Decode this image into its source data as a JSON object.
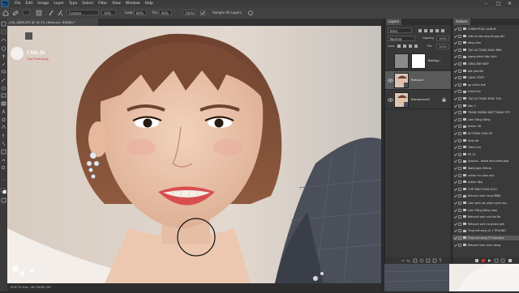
{
  "menubar": {
    "items": [
      "File",
      "Edit",
      "Image",
      "Layer",
      "Type",
      "Select",
      "Filter",
      "View",
      "Window",
      "Help"
    ]
  },
  "options": {
    "mode_value": "Custom",
    "flow_label": "Flow:",
    "flow_value": "10%",
    "smoothing_label": "Look:",
    "smoothing_value": "80%",
    "flow2_label": "Flo:",
    "flow2_value": "90%",
    "zoom_value": "100%",
    "sample_all_label": "Sample All Layers"
  },
  "document": {
    "tab_title": "LOA_0665.JPG @ 16.7% (Retouch, RGB/8) *",
    "watermark_line1": "Chia Sẻ",
    "watermark_line2": "Tạo Photoshop",
    "status_text": "16.67%   Doc: 46.1M/89.2M"
  },
  "layers_panel": {
    "tab_label": "Layers",
    "kind_label": "Kind",
    "blend_mode": "Normal",
    "opacity_label": "Opacity:",
    "opacity_value": "100%",
    "lock_label": "Lock:",
    "fill_label": "Fill:",
    "fill_value": "100%",
    "layers": [
      {
        "name": "Backgr...",
        "type": "mask"
      },
      {
        "name": "Retouch",
        "type": "photo"
      },
      {
        "name": "Background",
        "type": "photo"
      }
    ]
  },
  "actions_panel": {
    "tab_label": "Actions",
    "items": [
      {
        "label": "CHINH PHỤC ALBUM",
        "check": true
      },
      {
        "label": "viết và hòa ứng khung hắn",
        "check": true
      },
      {
        "label": "tăng cảm",
        "check": true
      },
      {
        "label": "TẠO ACTIONS XOAY ẢNH",
        "check": true
      },
      {
        "label": "mạng tránh đàu lành",
        "check": true
      },
      {
        "label": "LÊNG ẢNH ĐẸP",
        "check": true
      },
      {
        "label": "bật phá tắc",
        "check": true
      },
      {
        "label": "LÀNH TỐMT",
        "check": true
      },
      {
        "label": "ụp chính ảnh",
        "check": true
      },
      {
        "label": "tránh thu",
        "check": true
      },
      {
        "label": "TẠO ACTIONS XOAY THA",
        "check": true
      },
      {
        "label": "Ván 1",
        "check": true
      },
      {
        "label": "TRANG ĐIÊNG ĐẸP TRANG PTS",
        "check": true
      },
      {
        "label": "Làm Trắng Răng",
        "check": true
      },
      {
        "label": "Action 28",
        "check": true
      },
      {
        "label": "ACTIONS CHIA SẺ",
        "check": true
      },
      {
        "label": "khác đa",
        "check": true
      },
      {
        "label": "Tránh thu",
        "check": true
      },
      {
        "label": "PS 11",
        "check": true
      },
      {
        "label": "Actions - blend and clean.psq",
        "check": true
      },
      {
        "label": "Wall/Light Effects",
        "check": true
      },
      {
        "label": "action hu chan anh",
        "check": true
      },
      {
        "label": "action đẹp",
        "check": true
      },
      {
        "label": "THÊ MAN TUAN 2022",
        "check": true
      },
      {
        "label": "Retouch anh cong 6086",
        "check": true
      },
      {
        "label": "Làm sạch da phan mem mo...",
        "check": true
      },
      {
        "label": "Làm Trắng Răng mạo",
        "check": true
      },
      {
        "label": "Retouch anh cưa bai Ra",
        "check": true
      },
      {
        "label": "Retouch anh Ira photo Jom",
        "check": true
      },
      {
        "label": "Tung mẻ song di 1 TRUONG",
        "check": true
      },
      {
        "label": "Tung mẻ song TO the pam",
        "check": true,
        "selected": true
      },
      {
        "label": "Retouch anh chan dung",
        "check": true
      }
    ]
  },
  "colors": {
    "panel_bg": "#383838",
    "menubar_bg": "#3c3c3c",
    "selection": "#5a5a5a"
  }
}
